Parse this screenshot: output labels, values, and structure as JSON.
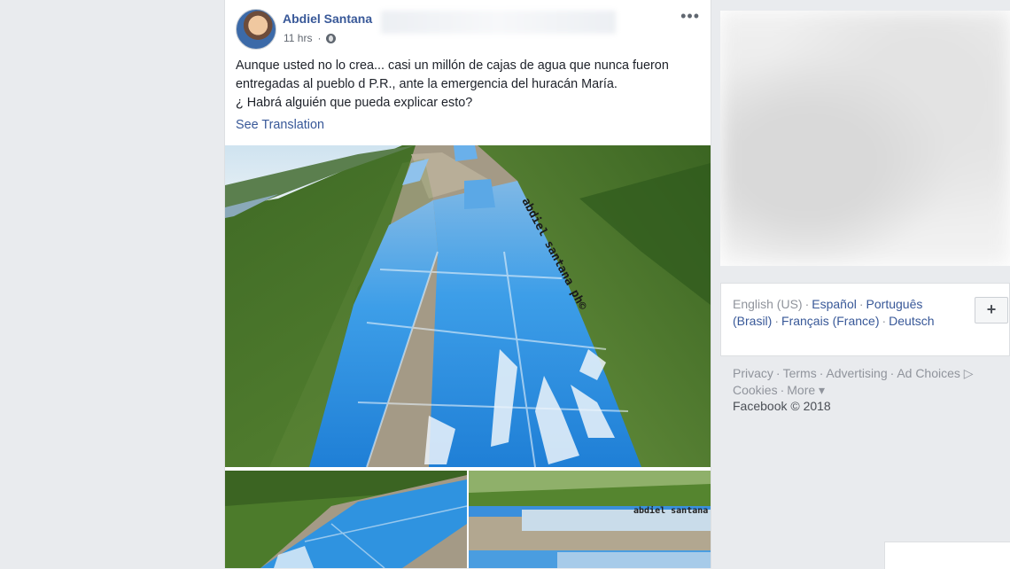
{
  "post": {
    "author": "Abdiel Santana",
    "time": "11 hrs",
    "text_lines": [
      "Aunque usted no lo crea... casi un millón de cajas de agua que nunca fueron",
      "entregadas al pueblo d P.R., ante la emergencia del huracán María.",
      "¿ Habrá alguién que pueda explicar esto?"
    ],
    "see_translation": "See Translation",
    "more_glyph": "•••",
    "watermark_main": "abdiel santana ph©",
    "watermark_sub": "abdiel santana p"
  },
  "sidebar": {
    "languages": {
      "current": "English (US)",
      "options": [
        "Español",
        "Português (Brasil)",
        "Français (France)",
        "Deutsch"
      ],
      "add_label": "+"
    },
    "footer_links": [
      "Privacy",
      "Terms",
      "Advertising",
      "Ad Choices ▷",
      "Cookies",
      "More ▾"
    ],
    "copyright": "Facebook © 2018"
  },
  "colors": {
    "page_bg": "#e9ebee",
    "link_blue": "#385898",
    "tarp_blue": "#2b8fd8",
    "grass_green": "#4f7a2e"
  }
}
